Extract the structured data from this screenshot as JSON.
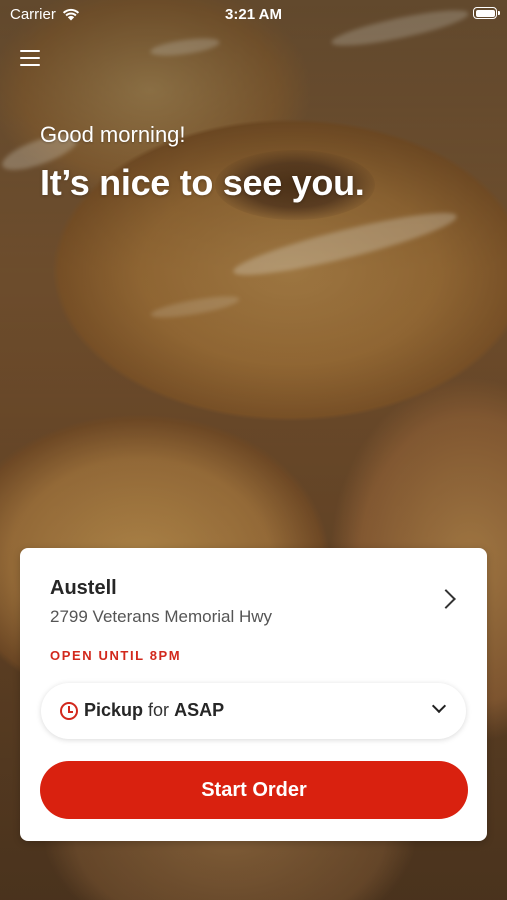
{
  "status_bar": {
    "carrier": "Carrier",
    "time": "3:21 AM"
  },
  "header": {
    "greeting": "Good morning!",
    "headline": "It’s nice to see you."
  },
  "store": {
    "name": "Austell",
    "address": "2799 Veterans Memorial Hwy",
    "hours_status": "OPEN UNTIL 8PM"
  },
  "order": {
    "method": "Pickup",
    "connector": "for",
    "time": "ASAP",
    "start_label": "Start Order"
  },
  "colors": {
    "accent": "#d9210f",
    "status_text": "#d2281c"
  },
  "icons": {
    "menu": "hamburger-menu-icon",
    "wifi": "wifi-icon",
    "battery": "battery-icon",
    "store_chevron": "chevron-right-icon",
    "clock": "clock-icon",
    "dropdown": "chevron-down-icon"
  }
}
